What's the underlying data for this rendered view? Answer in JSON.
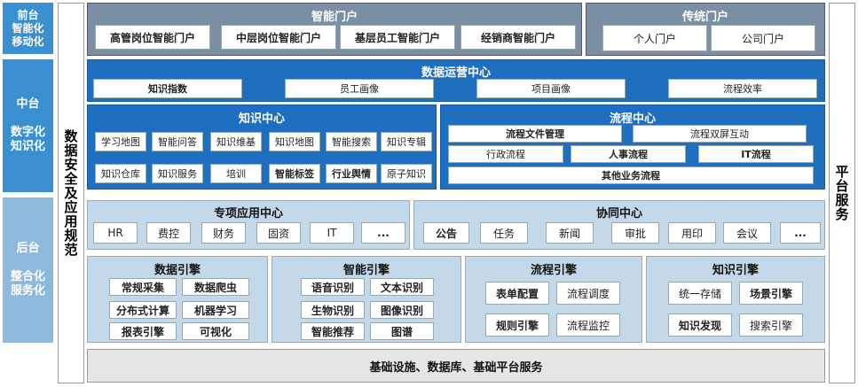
{
  "left": {
    "front": "前台\n智能化\n移动化",
    "middle": "中台\n\n数字化\n知识化",
    "back": "后台\n\n整合化\n服务化"
  },
  "security_col": "数据安全及应用规范",
  "platform_col": "平台服务",
  "smart_portal": {
    "title": "智能门户",
    "items": [
      "高管岗位智能门户",
      "中层岗位智能门户",
      "基层员工智能门户",
      "经销商智能门户"
    ]
  },
  "traditional_portal": {
    "title": "传统门户",
    "items": [
      "个人门户",
      "公司门户"
    ]
  },
  "data_ops": {
    "title": "数据运营中心",
    "items": [
      "知识指数",
      "员工画像",
      "项目画像",
      "流程效率"
    ]
  },
  "knowledge_center": {
    "title": "知识中心",
    "row1": [
      "学习地图",
      "智能问答",
      "知识维基",
      "知识地图",
      "智能搜索",
      "知识专辑"
    ],
    "row2": [
      "知识仓库",
      "知识服务",
      "培训",
      "智能标签",
      "行业舆情",
      "原子知识"
    ]
  },
  "process_center": {
    "title": "流程中心",
    "row1": [
      "流程文件管理",
      "流程双屏互动"
    ],
    "row2": [
      "行政流程",
      "人事流程",
      "IT流程"
    ],
    "row3": "其他业务流程"
  },
  "special_app": {
    "title": "专项应用中心",
    "items": [
      "HR",
      "费控",
      "财务",
      "固资",
      "IT",
      "..."
    ]
  },
  "collab": {
    "title": "协同中心",
    "items": [
      "公告",
      "任务",
      "新闻",
      "审批",
      "用印",
      "会议",
      "..."
    ]
  },
  "data_engine": {
    "title": "数据引擎",
    "items": [
      "常规采集",
      "数据爬虫",
      "分布式计算",
      "机器学习",
      "报表引擎",
      "可视化"
    ]
  },
  "ai_engine": {
    "title": "智能引擎",
    "items": [
      "语音识别",
      "文本识别",
      "生物识别",
      "图像识别",
      "智能推荐",
      "图谱"
    ]
  },
  "flow_engine": {
    "title": "流程引擎",
    "items": [
      "表单配置",
      "流程调度",
      "规则引擎",
      "流程监控"
    ]
  },
  "know_engine": {
    "title": "知识引擎",
    "items": [
      "统一存储",
      "场景引擎",
      "知识发现",
      "搜索引擎"
    ]
  },
  "infra": "基础设施、数据库、基础平台服务"
}
